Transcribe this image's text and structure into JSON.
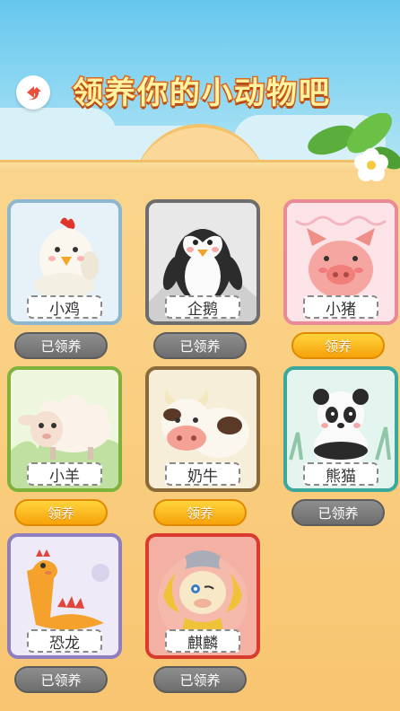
{
  "header": {
    "title": "领养你的小动物吧",
    "back_icon": "back-arrow-icon"
  },
  "colors": {
    "adopted_button": "#7a7a7a",
    "adopt_button": "#f9b41a",
    "title_stroke": "#e0661b"
  },
  "animals": [
    {
      "name": "小鸡",
      "button": "已领养",
      "status": "adopted",
      "frame": "#8db6cf",
      "bg": "#e6f1f8"
    },
    {
      "name": "企鹅",
      "button": "已领养",
      "status": "adopted",
      "frame": "#6d6d6d",
      "bg": "#e8e8e8"
    },
    {
      "name": "小猪",
      "button": "领养",
      "status": "available",
      "frame": "#e88a98",
      "bg": "#fbe3e7"
    },
    {
      "name": "小羊",
      "button": "领养",
      "status": "available",
      "frame": "#7fb23a",
      "bg": "#eef6dd"
    },
    {
      "name": "奶牛",
      "button": "领养",
      "status": "available",
      "frame": "#8a6a3b",
      "bg": "#f6eed8"
    },
    {
      "name": "熊猫",
      "button": "已领养",
      "status": "adopted",
      "frame": "#3aa89a",
      "bg": "#e4f4ef"
    },
    {
      "name": "恐龙",
      "button": "已领养",
      "status": "adopted",
      "frame": "#8f7ec0",
      "bg": "#eeeaf8"
    },
    {
      "name": "麒麟",
      "button": "已领养",
      "status": "adopted",
      "frame": "#d93b2f",
      "bg": "#f5b0a4"
    }
  ]
}
